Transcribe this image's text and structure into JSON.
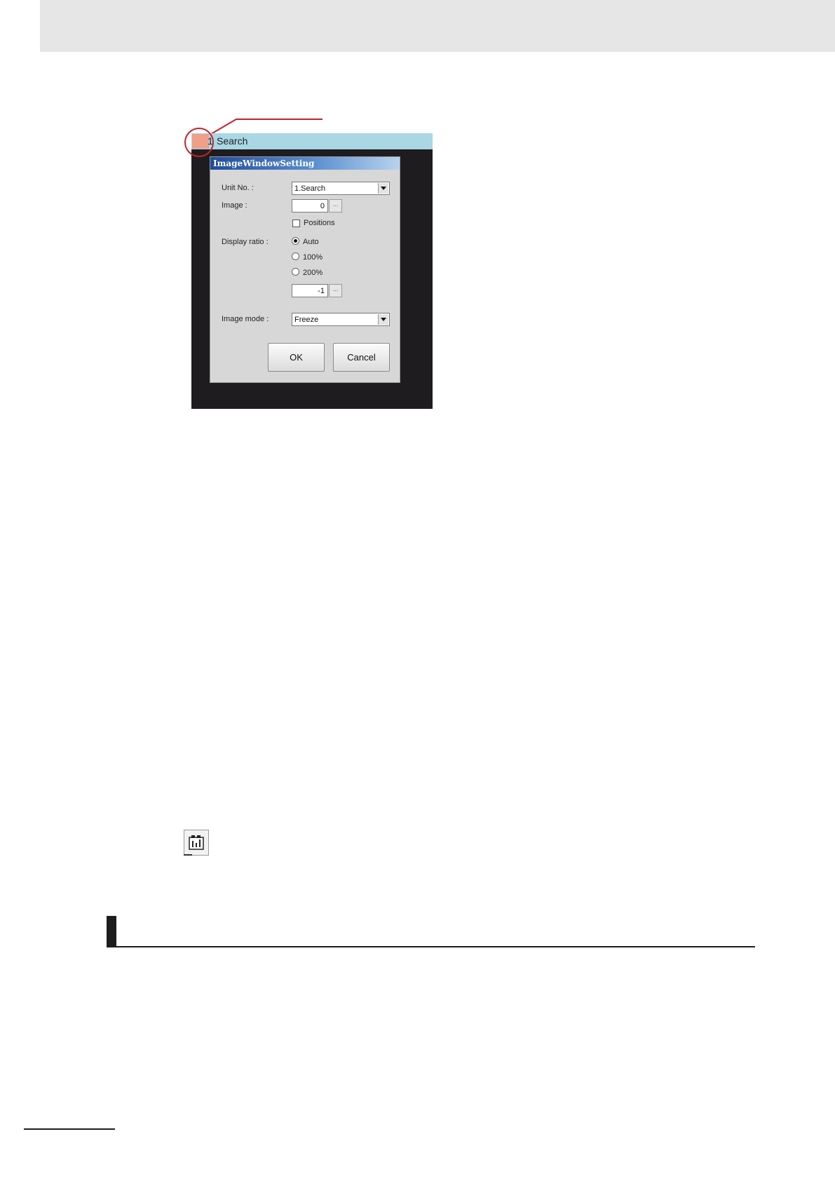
{
  "window": {
    "number": "1",
    "title": "Search"
  },
  "dialog": {
    "title": "ImageWindowSetting",
    "unit_no": {
      "label": "Unit No. :",
      "value": "1.Search"
    },
    "image": {
      "label": "Image :",
      "value": "0",
      "button": "..."
    },
    "positions": {
      "label": "Positions",
      "checked": false
    },
    "display_ratio": {
      "label": "Display ratio :",
      "options": [
        {
          "label": "Auto",
          "checked": true
        },
        {
          "label": "100%",
          "checked": false
        },
        {
          "label": "200%",
          "checked": false
        }
      ],
      "custom_value": "-1",
      "custom_button": "..."
    },
    "image_mode": {
      "label": "Image mode :",
      "value": "Freeze"
    },
    "ok_label": "OK",
    "cancel_label": "Cancel"
  },
  "colors": {
    "header_band": "#e6e6e6",
    "window_background": "#1f1c1f",
    "titlebar": "#a9d7e4",
    "highlight": "#c8202a",
    "menu_button": "#f0a088"
  },
  "icons": {
    "toolbar": "image-window-settings-icon"
  }
}
